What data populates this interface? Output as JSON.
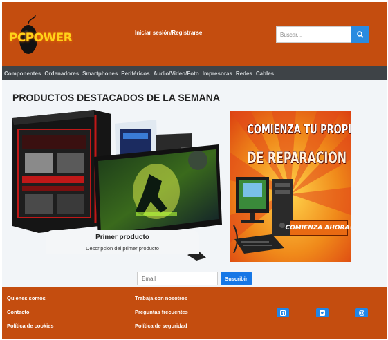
{
  "header": {
    "logo_text": "PCPOWER",
    "login_link": "Iniciar sesión/Registrarse",
    "search_placeholder": "Buscar...",
    "search_icon": "search-icon"
  },
  "nav": {
    "items": [
      "Componentes",
      "Ordenadores",
      "Smartphones",
      "Periféricos",
      "Audio/Video/Foto",
      "Impresoras",
      "Redes",
      "Cables"
    ]
  },
  "main": {
    "title": "PRODUCTOS DESTACADOS DE LA SEMANA",
    "carousel": {
      "item_title": "Primer producto",
      "item_description": "Descripción del primer producto"
    },
    "ad": {
      "line1": "COMIENZA TU PROPIO NEGOCIO",
      "line2": "DE REPARACION DE PC",
      "cta": "COMIENZA AHORA!"
    }
  },
  "newsletter": {
    "email_placeholder": "Email",
    "subscribe_label": "Suscribir"
  },
  "footer": {
    "col1": [
      "Quienes somos",
      "Contacto",
      "Política de cookies"
    ],
    "col2": [
      "Trabaja con nosotros",
      "Preguntas frecuentes",
      "Política de seguridad"
    ],
    "social_icons": [
      "facebook-icon",
      "twitter-icon",
      "instagram-icon"
    ]
  },
  "colors": {
    "brand": "#c44d0f",
    "nav": "#3e4347",
    "accent": "#1f86e8",
    "logo": "#ffd21a"
  }
}
